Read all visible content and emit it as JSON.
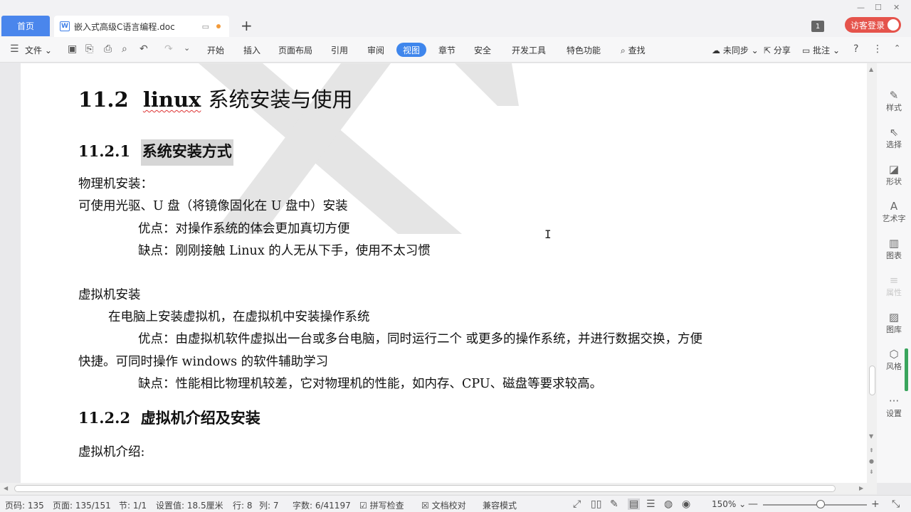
{
  "tabs": {
    "home": "首页",
    "doc_title": "嵌入式高级C语言编程.doc",
    "new_tab": "+"
  },
  "window": {
    "badge": "1",
    "login": "访客登录"
  },
  "menu": {
    "file": "文件",
    "items": [
      "开始",
      "插入",
      "页面布局",
      "引用",
      "审阅",
      "视图",
      "章节",
      "安全",
      "开发工具",
      "特色功能"
    ],
    "active": "视图",
    "search": "查找",
    "sync": "未同步",
    "share": "分享",
    "comment": "批注"
  },
  "document": {
    "h1_num": "11.2",
    "h1_word": "linux",
    "h1_rest": "系统安装与使用",
    "h2a_num": "11.2.1",
    "h2a_text": "系统安装方式",
    "p1": "物理机安装：",
    "p2": "可使用光驱、U 盘（将镜像固化在 U 盘中）安装",
    "p3": "优点：对操作系统的体会更加真切方便",
    "p4": "缺点：刚刚接触 Linux 的人无从下手，使用不太习惯",
    "p5": "虚拟机安装",
    "p6": "在电脑上安装虚拟机，在虚拟机中安装操作系统",
    "p7": "优点：由虚拟机软件虚拟出一台或多台电脑，同时运行二个  或更多的操作系统，并进行数据交换，方便",
    "p8": "快捷。可同时操作 windows 的软件辅助学习",
    "p9": "缺点：性能相比物理机较差，它对物理机的性能，如内存、CPU、磁盘等要求较高。",
    "h2b_num": "11.2.2",
    "h2b_text": "虚拟机介绍及安装",
    "p10": "虚拟机介绍:"
  },
  "right_panel": [
    "样式",
    "选择",
    "形状",
    "艺术字",
    "图表",
    "属性",
    "图库",
    "风格",
    "设置"
  ],
  "status": {
    "page_code": "页码: 135",
    "page": "页面: 135/151",
    "section": "节: 1/1",
    "setting": "设置值: 18.5厘米",
    "row": "行: 8",
    "col": "列: 7",
    "words": "字数: 6/41197",
    "spell": "拼写检查",
    "proof": "文档校对",
    "compat": "兼容模式",
    "zoom": "150%"
  }
}
